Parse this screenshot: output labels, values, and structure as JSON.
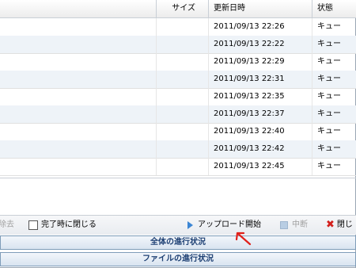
{
  "table": {
    "headers": {
      "name": "",
      "size": "サイズ",
      "date": "更新日時",
      "status": "状態"
    },
    "rows": [
      {
        "date": "2011/09/13 22:26",
        "status": "キュー"
      },
      {
        "date": "2011/09/13 22:22",
        "status": "キュー"
      },
      {
        "date": "2011/09/13 22:29",
        "status": "キュー"
      },
      {
        "date": "2011/09/13 22:31",
        "status": "キュー"
      },
      {
        "date": "2011/09/13 22:35",
        "status": "キュー"
      },
      {
        "date": "2011/09/13 22:37",
        "status": "キュー"
      },
      {
        "date": "2011/09/13 22:40",
        "status": "キュー"
      },
      {
        "date": "2011/09/13 22:42",
        "status": "キュー"
      },
      {
        "date": "2011/09/13 22:45",
        "status": "キュー"
      }
    ]
  },
  "toolbar": {
    "remove_label": "除去",
    "close_on_complete_label": "完了時に閉じる",
    "upload_label": "アップロード開始",
    "stop_label": "中断",
    "close_label": "閉じ"
  },
  "progress": {
    "overall_label": "全体の進行状況",
    "file_label": "ファイルの進行状況"
  }
}
